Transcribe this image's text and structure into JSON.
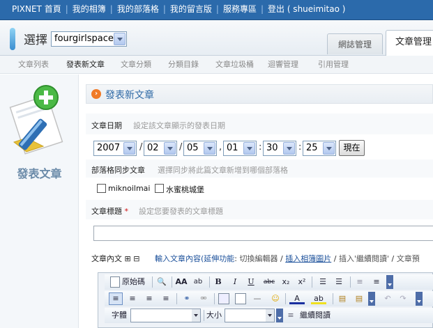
{
  "topnav": {
    "items": [
      "PIXNET 首頁",
      "我的相簿",
      "我的部落格",
      "我的留言版",
      "服務專區",
      "登出 ( shueimitao )"
    ]
  },
  "header": {
    "select_label": "選擇",
    "blog_name": "fourgirlspace",
    "tabs": [
      "網誌管理",
      "文章管理"
    ],
    "active_tab": "文章管理"
  },
  "subnav": {
    "items": [
      "文章列表",
      "發表新文章",
      "文章分類",
      "分類目錄",
      "文章垃圾桶",
      "迴響管理",
      "引用管理"
    ],
    "active": "發表新文章"
  },
  "sidebar": {
    "title": "發表文章"
  },
  "form": {
    "section_title": "發表新文章",
    "date": {
      "label": "文章日期",
      "hint": "設定該文章顯示的發表日期",
      "year": "2007",
      "month": "02",
      "day": "05",
      "hour": "01",
      "minute": "30",
      "second": "25",
      "sep_slash": "/",
      "sep_comma": ",",
      "sep_colon": ":",
      "now_button": "現在"
    },
    "sync": {
      "label": "部落格同步文章",
      "hint": "選擇同步將此篇文章新增到哪個部落格",
      "options": [
        "miknoilmai",
        "水蜜桃城堡"
      ]
    },
    "title": {
      "label": "文章標題",
      "required_mark": "*",
      "hint": "設定您要發表的文章標題",
      "value": ""
    },
    "content": {
      "label": "文章內文",
      "expand_icon": "⊞",
      "collapse_icon": "⊟",
      "prompt_prefix": "輸入文章內容(",
      "extended": "延伸功能",
      "colon": ":",
      "switch_editor": "切換編輯器",
      "slash": "/",
      "insert_album": "插入相簿圖片",
      "insert_more": "插入'繼續閱讀'",
      "more_cut": "文章預"
    }
  },
  "editor": {
    "source_label": "原始碼",
    "font_label": "字體",
    "size_label": "大小",
    "continue_label": "繼續閱讀"
  },
  "colors": {
    "topnav_bg": "#2b6aab",
    "accent_orange": "#f07a26",
    "link_blue": "#1a4f9a",
    "section_title": "#2f6aa6"
  }
}
